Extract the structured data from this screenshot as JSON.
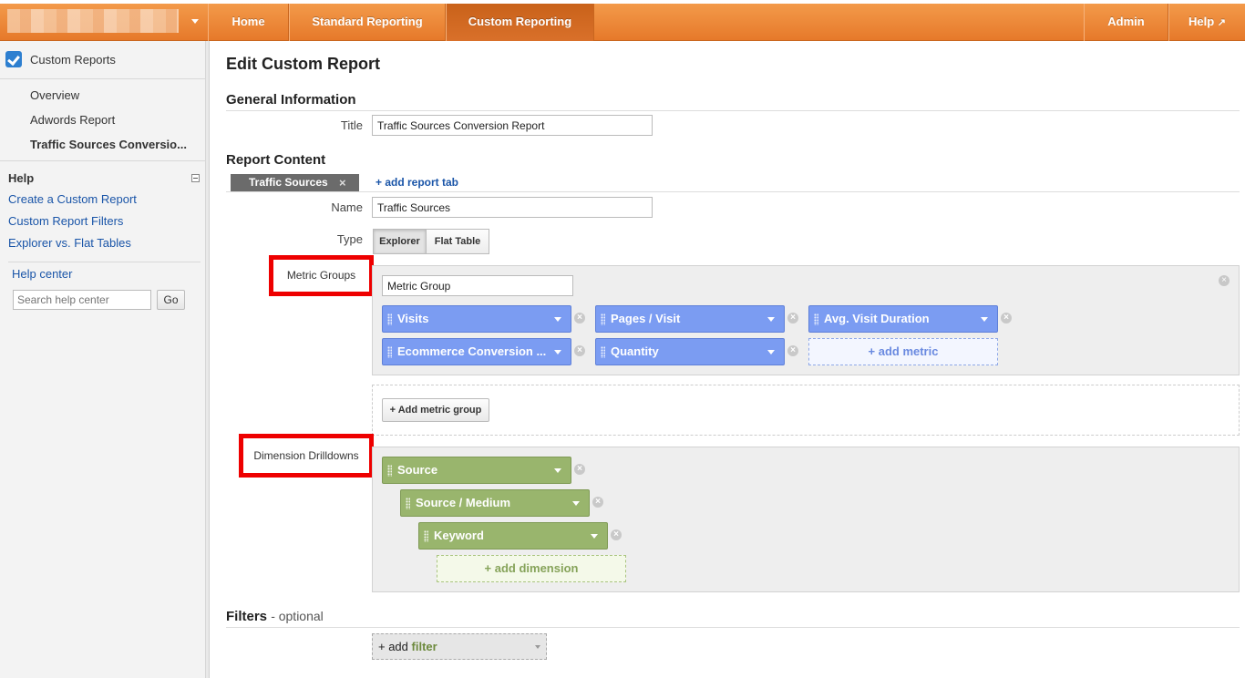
{
  "nav": {
    "tabs": [
      "Home",
      "Standard Reporting",
      "Custom Reporting"
    ],
    "admin": "Admin",
    "help": "Help"
  },
  "sidebar": {
    "title": "Custom Reports",
    "items": [
      "Overview",
      "Adwords Report",
      "Traffic Sources Conversio..."
    ],
    "help_title": "Help",
    "help_links": [
      "Create a Custom Report",
      "Custom Report Filters",
      "Explorer vs. Flat Tables"
    ],
    "help_center": "Help center",
    "search_placeholder": "Search help center",
    "go": "Go"
  },
  "main": {
    "title": "Edit Custom Report",
    "general_heading": "General Information",
    "title_label": "Title",
    "title_value": "Traffic Sources Conversion Report",
    "content_heading": "Report Content",
    "report_tab": "Traffic Sources",
    "report_tab_close": "×",
    "add_tab": "+ add report tab",
    "name_label": "Name",
    "name_value": "Traffic Sources",
    "type_label": "Type",
    "type_options": [
      "Explorer",
      "Flat Table"
    ],
    "metric_groups_label": "Metric Groups",
    "metric_group_name": "Metric Group",
    "metrics": [
      "Visits",
      "Pages / Visit",
      "Avg. Visit Duration",
      "Ecommerce Conversion ...",
      "Quantity"
    ],
    "add_metric": "+ add metric",
    "add_metric_group": "+ Add metric group",
    "dimension_label": "Dimension Drilldowns",
    "dimensions": [
      "Source",
      "Source / Medium",
      "Keyword"
    ],
    "add_dimension": "+ add dimension",
    "filters_heading": "Filters",
    "filters_optional": "- optional",
    "add_filter_prefix": "+ add",
    "add_filter_word": "filter"
  },
  "colors": {
    "brand_orange": "#e6792a",
    "metric_blue": "#7b9cf2",
    "dimension_green": "#99b56d",
    "highlight_red": "#ee0000"
  }
}
